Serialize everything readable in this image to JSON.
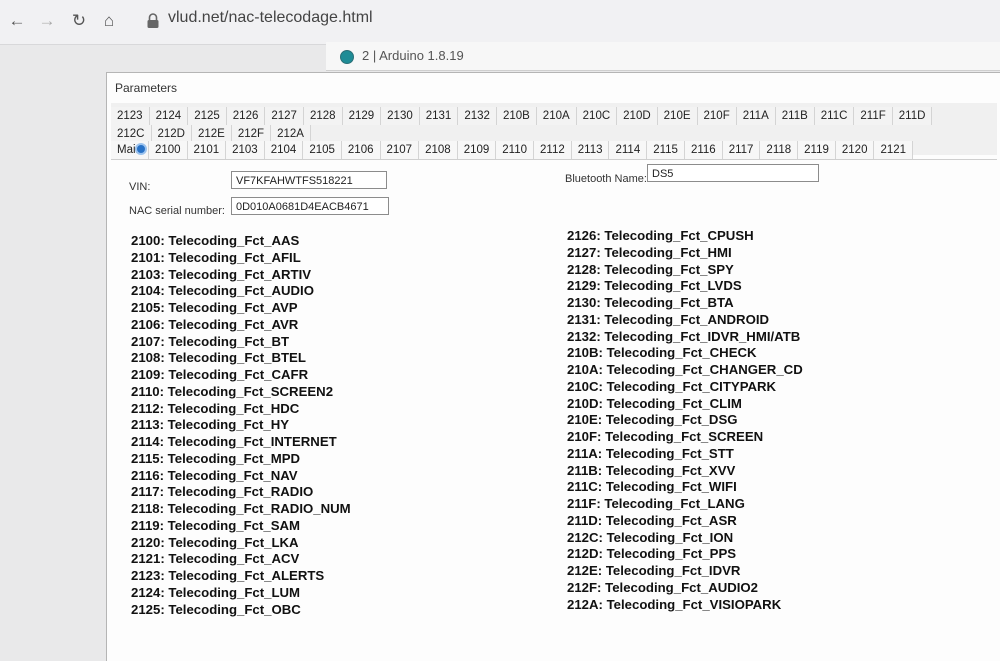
{
  "browser": {
    "url": "vlud.net/nac-telecodage.html",
    "back_icon": "←",
    "forward_icon": "→",
    "reload_icon": "↻",
    "home_icon": "⌂"
  },
  "arduino": {
    "title": "2 | Arduino 1.8.19"
  },
  "window": {
    "title": "Parameters"
  },
  "tabs": {
    "row1": [
      "2123",
      "2124",
      "2125",
      "2126",
      "2127",
      "2128",
      "2129",
      "2130",
      "2131",
      "2132",
      "210B",
      "210A",
      "210C",
      "210D",
      "210E",
      "210F",
      "211A",
      "211B",
      "211C",
      "211F",
      "211D"
    ],
    "row2": [
      "212C",
      "212D",
      "212E",
      "212F",
      "212A"
    ],
    "row3": [
      "Main",
      "2100",
      "2101",
      "2103",
      "2104",
      "2105",
      "2106",
      "2107",
      "2108",
      "2109",
      "2110",
      "2112",
      "2113",
      "2114",
      "2115",
      "2116",
      "2117",
      "2118",
      "2119",
      "2120",
      "2121"
    ]
  },
  "fields": {
    "vin_label": "VIN:",
    "vin_value": "VF7KFAHWTFS518221",
    "serial_label": "NAC serial number:",
    "serial_value": "0D010A0681D4EACB4671",
    "bt_label": "Bluetooth Name:",
    "bt_value": "DS5"
  },
  "left_codes": [
    "2100: Telecoding_Fct_AAS",
    "2101: Telecoding_Fct_AFIL",
    "2103: Telecoding_Fct_ARTIV",
    "2104: Telecoding_Fct_AUDIO",
    "2105: Telecoding_Fct_AVP",
    "2106: Telecoding_Fct_AVR",
    "2107: Telecoding_Fct_BT",
    "2108: Telecoding_Fct_BTEL",
    "2109: Telecoding_Fct_CAFR",
    "2110: Telecoding_Fct_SCREEN2",
    "2112: Telecoding_Fct_HDC",
    "2113: Telecoding_Fct_HY",
    "2114: Telecoding_Fct_INTERNET",
    "2115: Telecoding_Fct_MPD",
    "2116: Telecoding_Fct_NAV",
    "2117: Telecoding_Fct_RADIO",
    "2118: Telecoding_Fct_RADIO_NUM",
    "2119: Telecoding_Fct_SAM",
    "2120: Telecoding_Fct_LKA",
    "2121: Telecoding_Fct_ACV",
    "2123: Telecoding_Fct_ALERTS",
    "2124: Telecoding_Fct_LUM",
    "2125: Telecoding_Fct_OBC"
  ],
  "right_codes": [
    "2126: Telecoding_Fct_CPUSH",
    "2127: Telecoding_Fct_HMI",
    "2128: Telecoding_Fct_SPY",
    "2129: Telecoding_Fct_LVDS",
    "2130: Telecoding_Fct_BTA",
    "2131: Telecoding_Fct_ANDROID",
    "2132: Telecoding_Fct_IDVR_HMI/ATB",
    "210B: Telecoding_Fct_CHECK",
    "210A: Telecoding_Fct_CHANGER_CD",
    "210C: Telecoding_Fct_CITYPARK",
    "210D: Telecoding_Fct_CLIM",
    "210E: Telecoding_Fct_DSG",
    "210F: Telecoding_Fct_SCREEN",
    "211A: Telecoding_Fct_STT",
    "211B: Telecoding_Fct_XVV",
    "211C: Telecoding_Fct_WIFI",
    "211F: Telecoding_Fct_LANG",
    "211D: Telecoding_Fct_ASR",
    "212C: Telecoding_Fct_ION",
    "212D: Telecoding_Fct_PPS",
    "212E: Telecoding_Fct_IDVR",
    "212F: Telecoding_Fct_AUDIO2",
    "212A: Telecoding_Fct_VISIOPARK"
  ]
}
